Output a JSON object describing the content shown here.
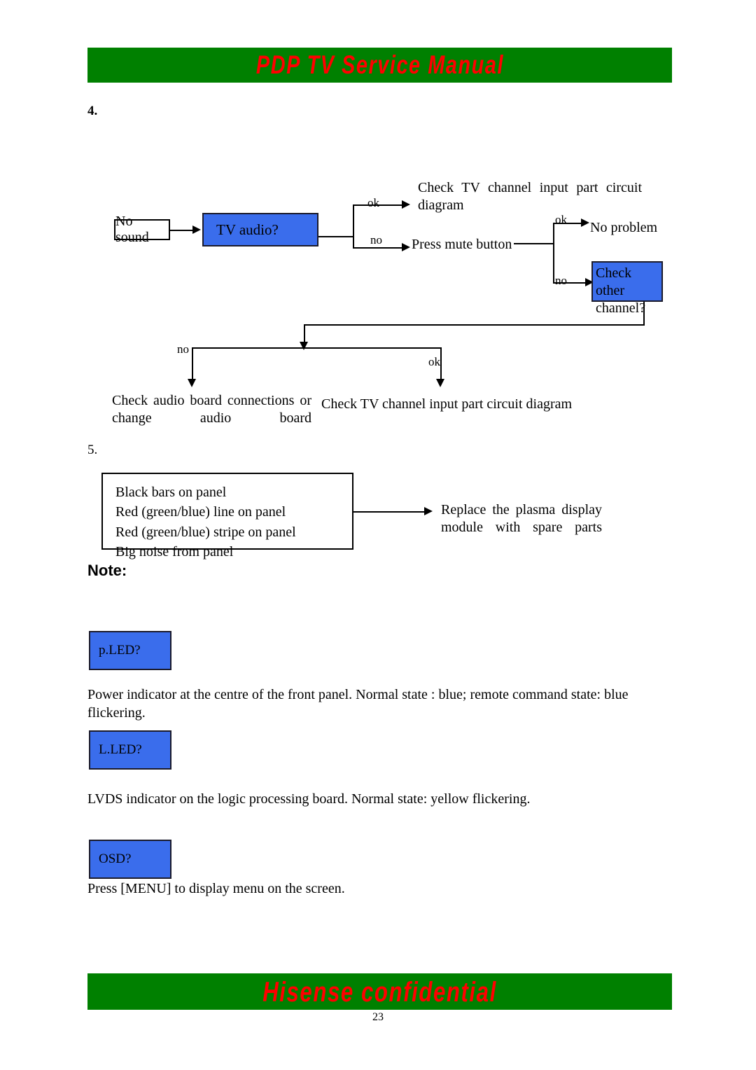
{
  "header": {
    "title": "PDP TV Service Manual"
  },
  "footer": {
    "title": "Hisense confidential",
    "page_number": "23"
  },
  "colors": {
    "banner_green": "#008000",
    "banner_text_red": "#ff0000",
    "box_blue": "#3A6DEC",
    "box_border": "#1b1b2b"
  },
  "section4": {
    "number": "4.",
    "start_box": "No sound",
    "decision_box": "TV audio?",
    "branch1_ok_label": "ok",
    "branch1_no_label": "no",
    "ok_target": "Check TV channel input part circuit diagram",
    "no_target": "Press mute button",
    "branch2_ok_label": "ok",
    "branch2_no_label": "no",
    "no_problem": "No problem",
    "check_other_channel": "Check other channel?",
    "branch3_no_label": "no",
    "branch3_ok_label": "ok",
    "no_result": "Check audio board connections or change audio board",
    "ok_result": "Check TV channel input part circuit diagram"
  },
  "section5": {
    "number": "5.",
    "symptoms": [
      "Black bars on panel",
      "Red (green/blue) line on panel",
      "Red (green/blue) stripe on panel",
      "Big noise from panel"
    ],
    "action": "Replace the plasma display module with spare parts"
  },
  "note": {
    "label": "Note:",
    "entries": [
      {
        "box": "p.LED?",
        "description": "Power indicator at the centre of the front panel. Normal state : blue; remote command state: blue flickering."
      },
      {
        "box": "L.LED?",
        "description": "LVDS indicator on the logic processing board. Normal state: yellow flickering."
      },
      {
        "box": "OSD?",
        "description": "Press [MENU] to display menu on the screen."
      }
    ]
  }
}
